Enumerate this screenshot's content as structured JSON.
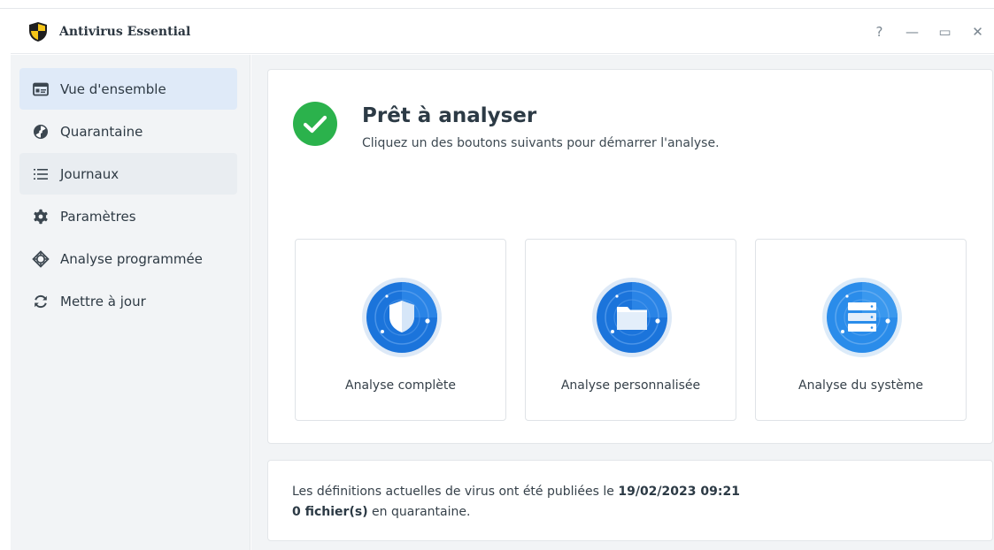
{
  "window": {
    "title": "Antivirus Essential",
    "controls": {
      "help": "?",
      "minimize": "—",
      "maximize": "▭",
      "close": "✕"
    }
  },
  "sidebar": {
    "items": [
      {
        "label": "Vue d'ensemble",
        "icon": "overview-card-icon",
        "state": "selected"
      },
      {
        "label": "Quarantaine",
        "icon": "biohazard-icon",
        "state": "normal"
      },
      {
        "label": "Journaux",
        "icon": "list-icon",
        "state": "hover"
      },
      {
        "label": "Paramètres",
        "icon": "gear-icon",
        "state": "normal"
      },
      {
        "label": "Analyse programmée",
        "icon": "crosshair-icon",
        "state": "normal"
      },
      {
        "label": "Mettre à jour",
        "icon": "refresh-icon",
        "state": "normal"
      }
    ]
  },
  "status": {
    "title": "Prêt à analyser",
    "subtitle": "Cliquez un des boutons suivants pour démarrer l'analyse.",
    "icon": "check-circle-icon"
  },
  "scan_cards": [
    {
      "label": "Analyse complète",
      "icon": "shield-scan-icon"
    },
    {
      "label": "Analyse personnalisée",
      "icon": "folder-scan-icon"
    },
    {
      "label": "Analyse du système",
      "icon": "server-scan-icon"
    }
  ],
  "info": {
    "definitions_text": "Les définitions actuelles de virus ont été publiées le",
    "definitions_date": "19/02/2023 09:21",
    "quarantine_count": "0 fichier(s)",
    "quarantine_text": "en quarantaine."
  },
  "colors": {
    "accent_blue": "#1e7fe0",
    "success_green": "#2bb24c",
    "sidebar_selected": "#dfeaf8"
  }
}
